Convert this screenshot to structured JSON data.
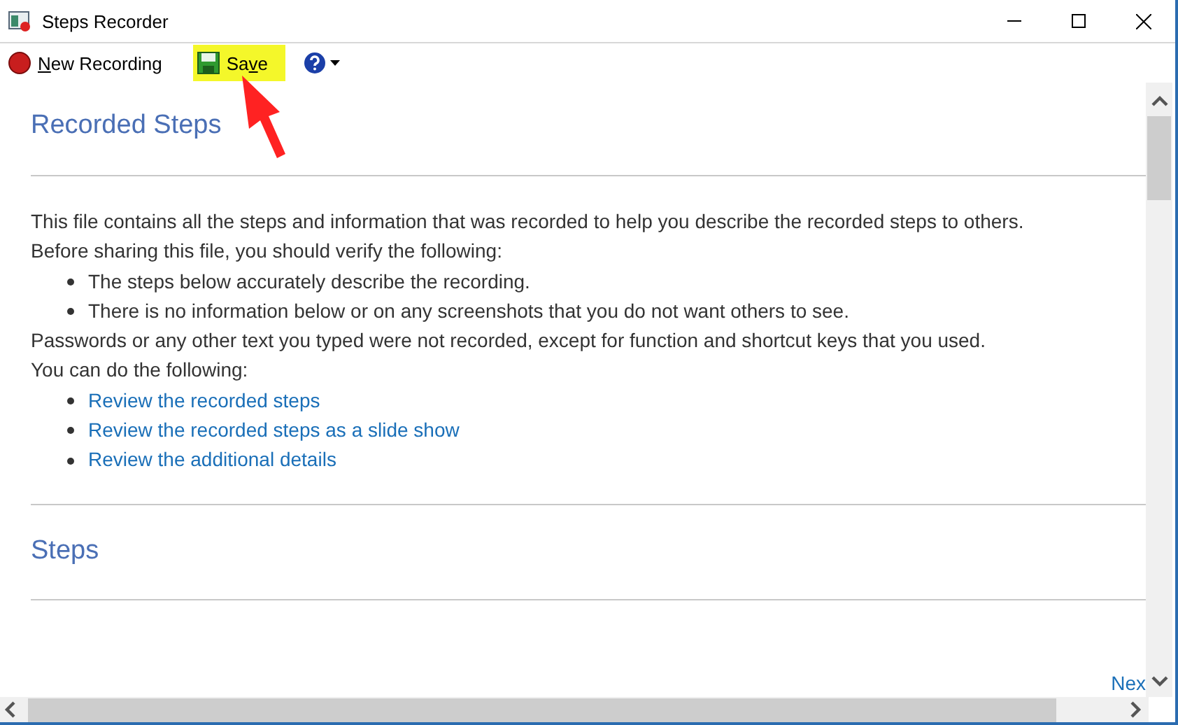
{
  "window": {
    "title": "Steps Recorder"
  },
  "toolbar": {
    "buttons": [
      {
        "kind": "record",
        "access_key": "N",
        "label_rest": "ew Recording",
        "highlighted": false
      },
      {
        "kind": "save",
        "label_start": "Sa",
        "access_key": "v",
        "label_rest": "e",
        "highlighted": true
      },
      {
        "kind": "help"
      }
    ]
  },
  "document": {
    "title": "Recorded Steps",
    "intro": [
      "This file contains all the steps and information that was recorded to help you describe the recorded steps to others.",
      "Before sharing this file, you should verify the following:"
    ],
    "checklist": [
      "The steps below accurately describe the recording.",
      "There is no information below or on any screenshots that you do not want others to see."
    ],
    "notes": [
      "Passwords or any other text you typed were not recorded, except for function and shortcut keys that you used.",
      "You can do the following:"
    ],
    "links": [
      "Review the recorded steps",
      "Review the recorded steps as a slide show",
      "Review the additional details"
    ],
    "steps_title": "Steps",
    "next_link": "Nex"
  }
}
